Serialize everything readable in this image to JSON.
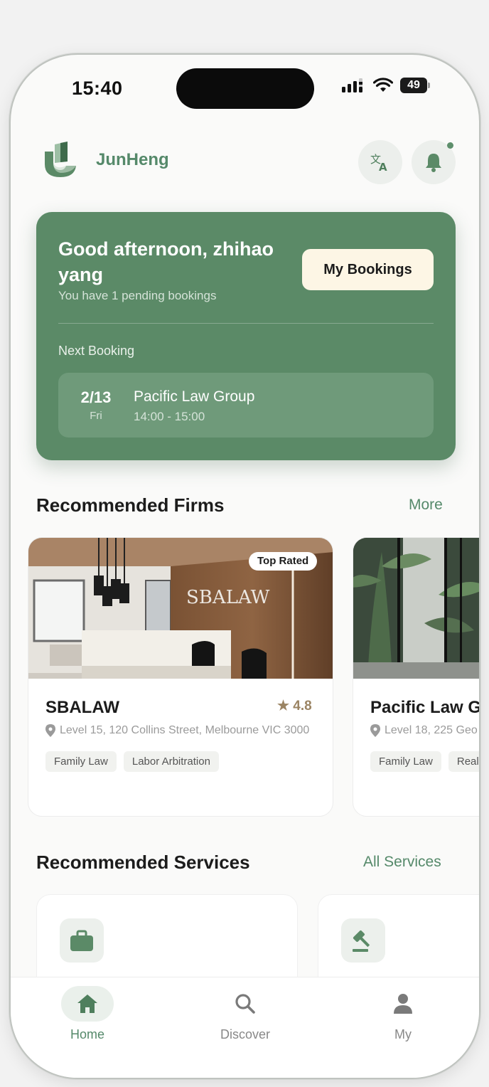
{
  "status_bar": {
    "time": "15:40",
    "battery": "49"
  },
  "header": {
    "brand": "JunHeng"
  },
  "greeting": {
    "title": "Good afternoon, zhihao yang",
    "subtitle": "You have 1 pending bookings",
    "bookings_button": "My Bookings",
    "next_label": "Next Booking",
    "next": {
      "date": "2/13",
      "day": "Fri",
      "firm": "Pacific Law Group",
      "time": "14:00 - 15:00"
    }
  },
  "firms_section": {
    "title": "Recommended Firms",
    "more": "More"
  },
  "firms": [
    {
      "badge": "Top Rated",
      "name": "SBALAW",
      "rating": "★ 4.8",
      "address": "Level 15, 120 Collins Street, Melbourne VIC 3000",
      "tags": [
        "Family Law",
        "Labor Arbitration"
      ],
      "sign": "SBALAW"
    },
    {
      "name": "Pacific Law G",
      "address": "Level 18, 225 Geo",
      "tags": [
        "Family Law",
        "Real"
      ]
    }
  ],
  "services_section": {
    "title": "Recommended Services",
    "link": "All Services"
  },
  "tabs": [
    {
      "label": "Home",
      "icon": "home-icon"
    },
    {
      "label": "Discover",
      "icon": "search-icon"
    },
    {
      "label": "My",
      "icon": "person-icon"
    }
  ],
  "colors": {
    "accent": "#5b8a67",
    "brand_text": "#55896a",
    "bookings_button_bg": "#fdf6e5",
    "rating": "#9b8463"
  }
}
